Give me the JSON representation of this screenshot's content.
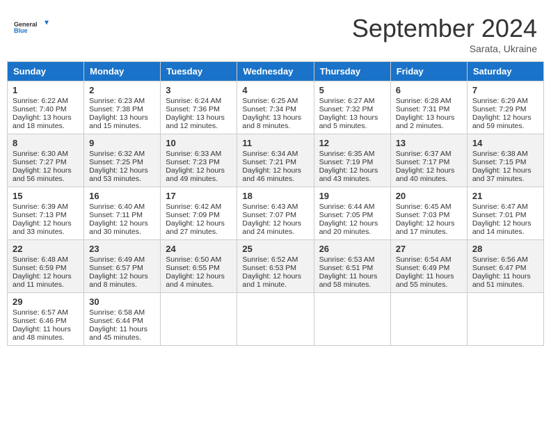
{
  "header": {
    "logo_general": "General",
    "logo_blue": "Blue",
    "month": "September 2024",
    "location": "Sarata, Ukraine"
  },
  "days_of_week": [
    "Sunday",
    "Monday",
    "Tuesday",
    "Wednesday",
    "Thursday",
    "Friday",
    "Saturday"
  ],
  "weeks": [
    [
      {
        "day": "1",
        "sunrise": "Sunrise: 6:22 AM",
        "sunset": "Sunset: 7:40 PM",
        "daylight": "Daylight: 13 hours and 18 minutes."
      },
      {
        "day": "2",
        "sunrise": "Sunrise: 6:23 AM",
        "sunset": "Sunset: 7:38 PM",
        "daylight": "Daylight: 13 hours and 15 minutes."
      },
      {
        "day": "3",
        "sunrise": "Sunrise: 6:24 AM",
        "sunset": "Sunset: 7:36 PM",
        "daylight": "Daylight: 13 hours and 12 minutes."
      },
      {
        "day": "4",
        "sunrise": "Sunrise: 6:25 AM",
        "sunset": "Sunset: 7:34 PM",
        "daylight": "Daylight: 13 hours and 8 minutes."
      },
      {
        "day": "5",
        "sunrise": "Sunrise: 6:27 AM",
        "sunset": "Sunset: 7:32 PM",
        "daylight": "Daylight: 13 hours and 5 minutes."
      },
      {
        "day": "6",
        "sunrise": "Sunrise: 6:28 AM",
        "sunset": "Sunset: 7:31 PM",
        "daylight": "Daylight: 13 hours and 2 minutes."
      },
      {
        "day": "7",
        "sunrise": "Sunrise: 6:29 AM",
        "sunset": "Sunset: 7:29 PM",
        "daylight": "Daylight: 12 hours and 59 minutes."
      }
    ],
    [
      {
        "day": "8",
        "sunrise": "Sunrise: 6:30 AM",
        "sunset": "Sunset: 7:27 PM",
        "daylight": "Daylight: 12 hours and 56 minutes."
      },
      {
        "day": "9",
        "sunrise": "Sunrise: 6:32 AM",
        "sunset": "Sunset: 7:25 PM",
        "daylight": "Daylight: 12 hours and 53 minutes."
      },
      {
        "day": "10",
        "sunrise": "Sunrise: 6:33 AM",
        "sunset": "Sunset: 7:23 PM",
        "daylight": "Daylight: 12 hours and 49 minutes."
      },
      {
        "day": "11",
        "sunrise": "Sunrise: 6:34 AM",
        "sunset": "Sunset: 7:21 PM",
        "daylight": "Daylight: 12 hours and 46 minutes."
      },
      {
        "day": "12",
        "sunrise": "Sunrise: 6:35 AM",
        "sunset": "Sunset: 7:19 PM",
        "daylight": "Daylight: 12 hours and 43 minutes."
      },
      {
        "day": "13",
        "sunrise": "Sunrise: 6:37 AM",
        "sunset": "Sunset: 7:17 PM",
        "daylight": "Daylight: 12 hours and 40 minutes."
      },
      {
        "day": "14",
        "sunrise": "Sunrise: 6:38 AM",
        "sunset": "Sunset: 7:15 PM",
        "daylight": "Daylight: 12 hours and 37 minutes."
      }
    ],
    [
      {
        "day": "15",
        "sunrise": "Sunrise: 6:39 AM",
        "sunset": "Sunset: 7:13 PM",
        "daylight": "Daylight: 12 hours and 33 minutes."
      },
      {
        "day": "16",
        "sunrise": "Sunrise: 6:40 AM",
        "sunset": "Sunset: 7:11 PM",
        "daylight": "Daylight: 12 hours and 30 minutes."
      },
      {
        "day": "17",
        "sunrise": "Sunrise: 6:42 AM",
        "sunset": "Sunset: 7:09 PM",
        "daylight": "Daylight: 12 hours and 27 minutes."
      },
      {
        "day": "18",
        "sunrise": "Sunrise: 6:43 AM",
        "sunset": "Sunset: 7:07 PM",
        "daylight": "Daylight: 12 hours and 24 minutes."
      },
      {
        "day": "19",
        "sunrise": "Sunrise: 6:44 AM",
        "sunset": "Sunset: 7:05 PM",
        "daylight": "Daylight: 12 hours and 20 minutes."
      },
      {
        "day": "20",
        "sunrise": "Sunrise: 6:45 AM",
        "sunset": "Sunset: 7:03 PM",
        "daylight": "Daylight: 12 hours and 17 minutes."
      },
      {
        "day": "21",
        "sunrise": "Sunrise: 6:47 AM",
        "sunset": "Sunset: 7:01 PM",
        "daylight": "Daylight: 12 hours and 14 minutes."
      }
    ],
    [
      {
        "day": "22",
        "sunrise": "Sunrise: 6:48 AM",
        "sunset": "Sunset: 6:59 PM",
        "daylight": "Daylight: 12 hours and 11 minutes."
      },
      {
        "day": "23",
        "sunrise": "Sunrise: 6:49 AM",
        "sunset": "Sunset: 6:57 PM",
        "daylight": "Daylight: 12 hours and 8 minutes."
      },
      {
        "day": "24",
        "sunrise": "Sunrise: 6:50 AM",
        "sunset": "Sunset: 6:55 PM",
        "daylight": "Daylight: 12 hours and 4 minutes."
      },
      {
        "day": "25",
        "sunrise": "Sunrise: 6:52 AM",
        "sunset": "Sunset: 6:53 PM",
        "daylight": "Daylight: 12 hours and 1 minute."
      },
      {
        "day": "26",
        "sunrise": "Sunrise: 6:53 AM",
        "sunset": "Sunset: 6:51 PM",
        "daylight": "Daylight: 11 hours and 58 minutes."
      },
      {
        "day": "27",
        "sunrise": "Sunrise: 6:54 AM",
        "sunset": "Sunset: 6:49 PM",
        "daylight": "Daylight: 11 hours and 55 minutes."
      },
      {
        "day": "28",
        "sunrise": "Sunrise: 6:56 AM",
        "sunset": "Sunset: 6:47 PM",
        "daylight": "Daylight: 11 hours and 51 minutes."
      }
    ],
    [
      {
        "day": "29",
        "sunrise": "Sunrise: 6:57 AM",
        "sunset": "Sunset: 6:46 PM",
        "daylight": "Daylight: 11 hours and 48 minutes."
      },
      {
        "day": "30",
        "sunrise": "Sunrise: 6:58 AM",
        "sunset": "Sunset: 6:44 PM",
        "daylight": "Daylight: 11 hours and 45 minutes."
      },
      null,
      null,
      null,
      null,
      null
    ]
  ]
}
